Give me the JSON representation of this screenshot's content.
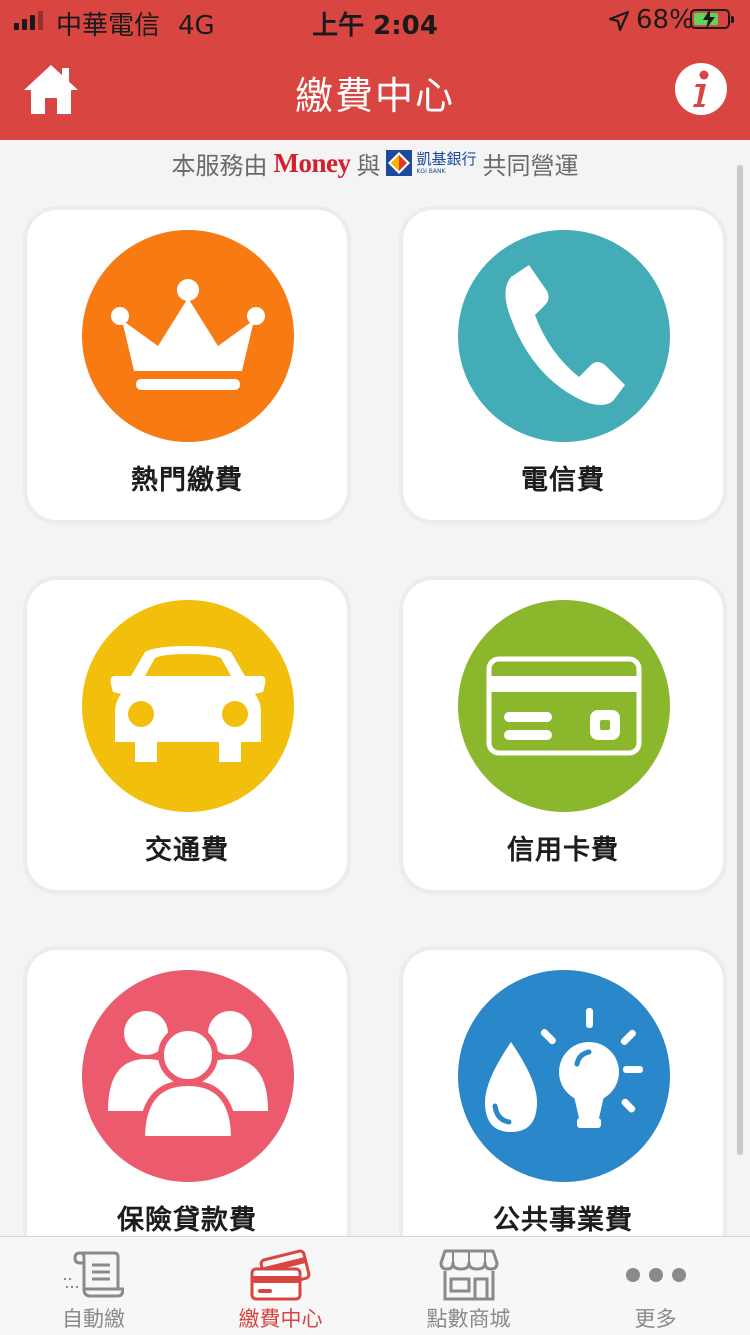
{
  "status_bar": {
    "carrier": "中華電信",
    "network": "4G",
    "time": "上午 2:04",
    "battery": "68%"
  },
  "nav": {
    "title": "繳費中心"
  },
  "sponsor": {
    "prefix": "本服務由",
    "brand": "Money",
    "joiner": "與",
    "bank_name": "凱基銀行",
    "bank_en": "KGI BANK",
    "suffix": "共同營運"
  },
  "categories": [
    {
      "label": "熱門繳費",
      "icon": "crown-icon",
      "color": "#f77a12"
    },
    {
      "label": "電信費",
      "icon": "phone-icon",
      "color": "#43acb6"
    },
    {
      "label": "交通費",
      "icon": "car-icon",
      "color": "#f1bf0c"
    },
    {
      "label": "信用卡費",
      "icon": "credit-card-icon",
      "color": "#8bb72d"
    },
    {
      "label": "保險貸款費",
      "icon": "people-icon",
      "color": "#ec5a6d"
    },
    {
      "label": "公共事業費",
      "icon": "water-bulb-icon",
      "color": "#2a87c9"
    }
  ],
  "tabs": [
    {
      "label": "自動繳",
      "icon": "scroll-icon",
      "active": false
    },
    {
      "label": "繳費中心",
      "icon": "cards-icon",
      "active": true
    },
    {
      "label": "點數商城",
      "icon": "store-icon",
      "active": false
    },
    {
      "label": "更多",
      "icon": "more-dots-icon",
      "active": false
    }
  ],
  "theme": {
    "brand_red": "#d94641",
    "active_tab": "#d94641",
    "inactive_tab": "#8a8a8a"
  }
}
